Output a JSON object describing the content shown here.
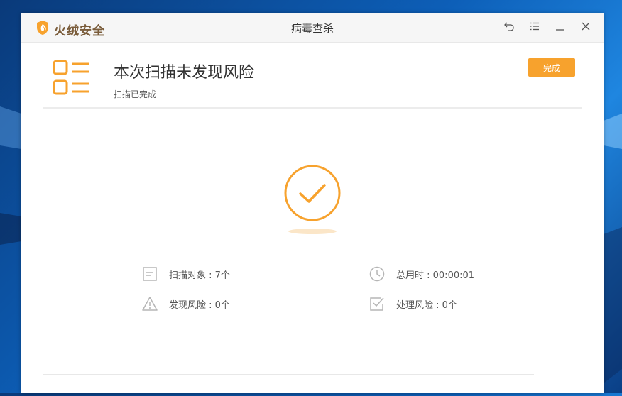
{
  "app": {
    "brand": "火绒安全",
    "window_title": "病毒查杀"
  },
  "header": {
    "title": "本次扫描未发现风险",
    "subtitle": "扫描已完成",
    "done_label": "完成"
  },
  "stats": {
    "scan_objects": "扫描对象 : 7个",
    "total_time": "总用时 : 00:00:01",
    "risks_found": "发现风险 : 0个",
    "risks_handled": "处理风险 : 0个"
  },
  "colors": {
    "accent": "#f7a22d",
    "brand_text": "#7a5c3a",
    "icon_gray": "#b5b5b5"
  },
  "icons": [
    "fire-shield-icon",
    "back-icon",
    "menu-icon",
    "minimize-icon",
    "close-icon",
    "list-icon",
    "check-circle-icon",
    "document-icon",
    "clock-icon",
    "warning-icon",
    "checkbox-icon"
  ]
}
